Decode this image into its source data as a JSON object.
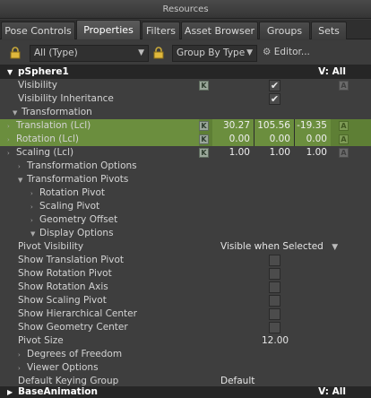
{
  "window": {
    "title": "Resources"
  },
  "tabs": [
    {
      "label": "Pose Controls"
    },
    {
      "label": "Properties"
    },
    {
      "label": "Filters"
    },
    {
      "label": "Asset Browser"
    },
    {
      "label": "Groups"
    },
    {
      "label": "Sets"
    }
  ],
  "toolbar": {
    "type_filter": "All (Type)",
    "group_by": "Group By Type",
    "editor_label": "Editor..."
  },
  "header": {
    "object": "pSphere1",
    "visibility": "V: All"
  },
  "rows": {
    "visibility": "Visibility",
    "visibility_inheritance": "Visibility Inheritance",
    "transformation": "Transformation",
    "translation": {
      "label": "Translation (Lcl)",
      "x": "30.27",
      "y": "105.56",
      "z": "-19.35"
    },
    "rotation": {
      "label": "Rotation (Lcl)",
      "x": "0.00",
      "y": "0.00",
      "z": "0.00"
    },
    "scaling": {
      "label": "Scaling (Lcl)",
      "x": "1.00",
      "y": "1.00",
      "z": "1.00"
    },
    "transformation_options": "Transformation Options",
    "transformation_pivots": "Transformation Pivots",
    "rotation_pivot": "Rotation Pivot",
    "scaling_pivot": "Scaling Pivot",
    "geometry_offset": "Geometry Offset",
    "display_options": "Display Options",
    "pivot_visibility": {
      "label": "Pivot Visibility",
      "value": "Visible when Selected"
    },
    "show_translation_pivot": "Show Translation Pivot",
    "show_rotation_pivot": "Show Rotation Pivot",
    "show_rotation_axis": "Show Rotation Axis",
    "show_scaling_pivot": "Show Scaling Pivot",
    "show_hierarchical_center": "Show Hierarchical Center",
    "show_geometry_center": "Show Geometry Center",
    "pivot_size": {
      "label": "Pivot Size",
      "value": "12.00"
    },
    "degrees_of_freedom": "Degrees of Freedom",
    "viewer_options": "Viewer Options",
    "default_keying_group": {
      "label": "Default Keying Group",
      "value": "Default"
    }
  },
  "footer_header": {
    "object": "BaseAnimation",
    "visibility": "V: All"
  },
  "glyphs": {
    "key": "K",
    "anim": "A",
    "check": "✔",
    "expanded": "▼",
    "collapsed": "›"
  }
}
